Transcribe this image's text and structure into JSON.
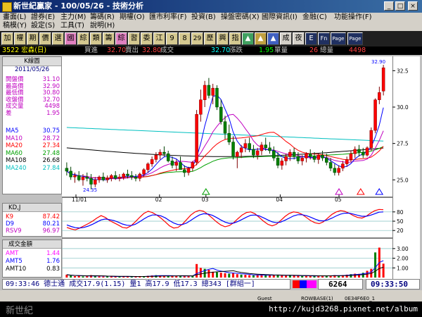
{
  "window": {
    "title": "新世紀贏家 - 100/05/26 - 技術分析"
  },
  "menu": {
    "row1": [
      "畫面(L)",
      "證券(E)",
      "主力(M)",
      "籌碼(R)",
      "期權(O)",
      "匯市利率(F)",
      "投資(B)",
      "操盤密碼(X)",
      "國際資訊(I)",
      "金融(C)",
      "功能操作(F)"
    ],
    "row2": [
      "稿模(Y)",
      "設定(S)",
      "工具(T)",
      "說明(H)"
    ]
  },
  "toolbar": {
    "buttons": [
      "加",
      "權",
      "期",
      "價",
      "選",
      "國",
      "綜",
      "類",
      "籌",
      "綜",
      "習",
      "委",
      "江",
      "9",
      "8",
      "29",
      "歷",
      "興",
      "指",
      "▲",
      "▲",
      "▲",
      "成",
      "夜",
      "E",
      "Fn",
      "Page",
      "Page"
    ]
  },
  "quote": {
    "name": "3522 宏森(日)",
    "buy_label": "買進",
    "buy": "32.70",
    "sell_label": "賣出",
    "sell": "32.80",
    "deal_label": "成交",
    "deal": "32.70",
    "change_label": "漲跌",
    "change": "1.95",
    "vol_label": "單量",
    "vol": "26",
    "total_label": "總量",
    "total": "4498"
  },
  "kpanel": {
    "title": "K線圖",
    "date": "2011/05/26",
    "rows": [
      {
        "label": "開盤價",
        "value": "31.10",
        "color": "#c000c0"
      },
      {
        "label": "最高價",
        "value": "32.90",
        "color": "#c000c0"
      },
      {
        "label": "最低價",
        "value": "30.80",
        "color": "#c000c0"
      },
      {
        "label": "收盤價",
        "value": "32.70",
        "color": "#c000c0"
      },
      {
        "label": "成交量",
        "value": "4498",
        "color": "#c000c0"
      },
      {
        "label": "差",
        "value": "1.95",
        "color": "#c000c0"
      },
      {
        "label": "MA5",
        "value": "30.75",
        "color": "#0000ff"
      },
      {
        "label": "MA10",
        "value": "28.72",
        "color": "#c000c0"
      },
      {
        "label": "MA20",
        "value": "27.34",
        "color": "#ff0000"
      },
      {
        "label": "MA60",
        "value": "27.48",
        "color": "#00a000"
      },
      {
        "label": "MA108",
        "value": "26.68",
        "color": "#000000"
      },
      {
        "label": "MA240",
        "value": "27.84",
        "color": "#00c0c0"
      }
    ]
  },
  "kdpanel": {
    "title": "KD,J",
    "rows": [
      {
        "label": "K9",
        "value": "87.42",
        "color": "#ff0000"
      },
      {
        "label": "D9",
        "value": "80.21",
        "color": "#0000ff"
      },
      {
        "label": "RSV9",
        "value": "96.97",
        "color": "#c000c0"
      }
    ]
  },
  "amtpanel": {
    "title": "成交金額",
    "rows": [
      {
        "label": "AMT",
        "value": "1.44",
        "color": "#ff00ff"
      },
      {
        "label": "AMT5",
        "value": "1.76",
        "color": "#0000ff"
      },
      {
        "label": "AMT10",
        "value": "0.83",
        "color": "#000000"
      }
    ]
  },
  "chart_data": [
    {
      "type": "candlestick",
      "title": "K線圖",
      "x_labels": [
        "11/01",
        "02",
        "03",
        "04",
        "05"
      ],
      "y_ticks": [
        "32.5",
        "30.0",
        "27.5",
        "25.0"
      ],
      "ylim": [
        24,
        33
      ],
      "high_label": "32.90",
      "low_label": "24.35",
      "candles": [
        [
          25.8,
          26.2,
          25.3,
          25.6
        ],
        [
          25.6,
          25.9,
          25.0,
          25.2
        ],
        [
          25.2,
          25.5,
          24.8,
          25.3
        ],
        [
          25.3,
          25.6,
          24.9,
          25.0
        ],
        [
          25.0,
          25.4,
          24.6,
          25.2
        ],
        [
          25.2,
          25.5,
          24.9,
          25.1
        ],
        [
          25.1,
          25.4,
          24.35,
          24.7
        ],
        [
          24.7,
          25.2,
          24.5,
          25.0
        ],
        [
          25.0,
          25.3,
          24.8,
          25.2
        ],
        [
          25.2,
          25.5,
          24.9,
          25.0
        ],
        [
          25.0,
          25.3,
          24.8,
          25.1
        ],
        [
          25.1,
          25.4,
          24.9,
          25.3
        ],
        [
          25.3,
          25.6,
          25.0,
          25.1
        ],
        [
          25.1,
          25.4,
          24.9,
          25.2
        ],
        [
          25.2,
          25.5,
          25.0,
          25.4
        ],
        [
          25.4,
          25.7,
          25.1,
          25.3
        ],
        [
          25.3,
          25.6,
          25.0,
          25.2
        ],
        [
          25.2,
          25.4,
          24.9,
          25.1
        ],
        [
          25.1,
          25.5,
          24.9,
          25.4
        ],
        [
          25.4,
          25.8,
          25.2,
          25.7
        ],
        [
          25.7,
          26.2,
          25.5,
          26.1
        ],
        [
          26.1,
          26.6,
          25.9,
          26.4
        ],
        [
          26.4,
          26.9,
          26.2,
          26.7
        ],
        [
          26.7,
          27.1,
          26.4,
          26.9
        ],
        [
          26.9,
          27.3,
          26.6,
          26.8
        ],
        [
          26.8,
          27.0,
          26.2,
          26.3
        ],
        [
          26.3,
          26.6,
          25.8,
          26.0
        ],
        [
          26.0,
          26.4,
          25.6,
          26.2
        ],
        [
          26.2,
          26.6,
          25.9,
          25.7
        ],
        [
          25.7,
          26.0,
          25.2,
          25.5
        ],
        [
          25.5,
          25.9,
          25.3,
          25.8
        ],
        [
          25.8,
          26.3,
          25.6,
          26.2
        ],
        [
          26.2,
          29.8,
          26.0,
          29.5
        ],
        [
          29.5,
          31.2,
          29.0,
          30.5
        ],
        [
          30.5,
          31.8,
          30.0,
          31.5
        ],
        [
          31.5,
          32.0,
          30.6,
          30.8
        ],
        [
          30.8,
          31.6,
          30.2,
          31.3
        ],
        [
          31.3,
          31.5,
          29.8,
          30.0
        ],
        [
          30.0,
          30.5,
          28.8,
          29.0
        ],
        [
          29.0,
          29.4,
          27.8,
          28.2
        ],
        [
          28.2,
          28.8,
          27.4,
          27.6
        ],
        [
          27.6,
          28.0,
          26.4,
          26.6
        ],
        [
          26.6,
          27.0,
          25.8,
          26.9
        ],
        [
          26.9,
          27.4,
          26.5,
          27.2
        ],
        [
          27.2,
          27.8,
          26.9,
          27.5
        ],
        [
          27.5,
          27.9,
          26.9,
          27.1
        ],
        [
          27.1,
          27.4,
          26.5,
          26.7
        ],
        [
          26.7,
          27.2,
          26.4,
          27.0
        ],
        [
          27.0,
          27.6,
          26.7,
          27.4
        ],
        [
          27.4,
          27.9,
          27.0,
          27.2
        ],
        [
          27.2,
          27.6,
          26.8,
          27.0
        ],
        [
          27.0,
          27.3,
          26.3,
          26.5
        ],
        [
          26.5,
          26.9,
          25.8,
          26.0
        ],
        [
          26.0,
          26.5,
          25.7,
          26.3
        ],
        [
          26.3,
          26.8,
          26.0,
          26.6
        ],
        [
          26.6,
          27.1,
          26.3,
          26.9
        ],
        [
          26.9,
          27.2,
          26.4,
          26.6
        ],
        [
          26.6,
          26.9,
          26.1,
          26.3
        ],
        [
          26.3,
          26.7,
          26.0,
          26.5
        ],
        [
          26.5,
          26.9,
          26.2,
          26.8
        ],
        [
          26.8,
          27.1,
          26.4,
          26.6
        ],
        [
          26.6,
          26.9,
          26.2,
          26.4
        ],
        [
          26.4,
          26.8,
          26.1,
          26.7
        ],
        [
          26.7,
          27.0,
          26.3,
          26.5
        ],
        [
          26.5,
          26.8,
          26.0,
          26.2
        ],
        [
          26.2,
          26.5,
          25.6,
          25.8
        ],
        [
          25.8,
          26.1,
          25.3,
          25.5
        ],
        [
          25.5,
          26.0,
          25.3,
          25.8
        ],
        [
          25.8,
          26.3,
          25.6,
          26.1
        ],
        [
          26.1,
          26.6,
          25.9,
          26.4
        ],
        [
          26.4,
          27.0,
          26.2,
          26.8
        ],
        [
          26.8,
          27.3,
          26.5,
          27.1
        ],
        [
          27.1,
          27.4,
          26.6,
          26.9
        ],
        [
          26.9,
          27.2,
          26.5,
          26.7
        ],
        [
          26.7,
          27.3,
          26.6,
          27.2
        ],
        [
          27.2,
          28.6,
          27.0,
          28.4
        ],
        [
          28.4,
          30.6,
          28.2,
          30.5
        ],
        [
          30.5,
          31.4,
          30.2,
          31.0
        ],
        [
          31.1,
          32.9,
          30.8,
          32.7
        ]
      ]
    },
    {
      "type": "line",
      "title": "KD,J",
      "y_ticks": [
        "80",
        "50",
        "20"
      ],
      "ylim": [
        0,
        100
      ],
      "series": [
        {
          "name": "K9",
          "color": "#ff0000",
          "values": [
            30,
            25,
            22,
            28,
            35,
            42,
            50,
            60,
            68,
            62,
            52,
            45,
            38,
            30,
            28,
            35,
            48,
            62,
            75,
            82,
            78,
            70,
            60,
            48,
            35,
            28,
            30,
            40,
            55,
            70,
            80,
            85,
            82,
            72,
            60,
            48,
            38,
            32,
            36,
            45,
            58,
            70,
            78,
            80,
            74,
            62,
            50,
            40,
            35,
            40,
            52,
            65,
            75,
            80,
            78,
            72,
            62,
            52,
            45,
            42,
            48,
            60,
            72,
            80,
            84,
            82,
            76,
            68,
            62,
            60,
            66,
            76,
            84,
            88,
            87
          ]
        },
        {
          "name": "D9",
          "color": "#0000ff",
          "values": [
            38,
            33,
            29,
            28,
            30,
            34,
            40,
            47,
            54,
            57,
            55,
            52,
            47,
            41,
            37,
            36,
            40,
            48,
            57,
            65,
            70,
            70,
            67,
            61,
            52,
            44,
            39,
            39,
            44,
            53,
            62,
            70,
            74,
            73,
            69,
            62,
            54,
            47,
            43,
            44,
            49,
            56,
            63,
            69,
            70,
            67,
            61,
            54,
            48,
            45,
            47,
            53,
            60,
            67,
            71,
            71,
            68,
            63,
            57,
            52,
            51,
            54,
            60,
            67,
            73,
            76,
            76,
            73,
            69,
            66,
            66,
            69,
            74,
            79,
            80
          ]
        }
      ]
    },
    {
      "type": "bar",
      "title": "成交金額",
      "y_ticks": [
        "3.00",
        "2.00",
        "1.00"
      ],
      "ylim": [
        0,
        3.5
      ],
      "values": [
        0.3,
        0.2,
        0.15,
        0.18,
        0.12,
        0.14,
        0.25,
        0.16,
        0.12,
        0.1,
        0.11,
        0.13,
        0.1,
        0.09,
        0.12,
        0.11,
        0.1,
        0.09,
        0.12,
        0.14,
        0.18,
        0.22,
        0.25,
        0.2,
        0.18,
        0.15,
        0.16,
        0.18,
        0.2,
        0.15,
        0.14,
        0.16,
        1.4,
        1.0,
        0.9,
        0.8,
        0.6,
        0.55,
        0.5,
        0.45,
        0.4,
        0.48,
        0.35,
        0.3,
        0.28,
        0.25,
        0.22,
        0.3,
        0.26,
        0.24,
        0.22,
        0.25,
        0.3,
        0.2,
        0.18,
        0.22,
        0.2,
        0.18,
        0.16,
        0.19,
        0.17,
        0.15,
        0.2,
        0.18,
        0.16,
        0.22,
        0.25,
        0.2,
        0.24,
        0.3,
        0.35,
        0.4,
        0.38,
        0.5,
        0.7,
        0.9,
        2.6,
        3.1,
        1.44
      ],
      "series_lines": [
        {
          "name": "AMT5",
          "color": "#0000ff"
        },
        {
          "name": "AMT10",
          "color": "#000000"
        }
      ]
    }
  ],
  "ticker": {
    "text": "09:33:46 德士通 成交17.9(1.15) 量1 高17.9 低17.3 總343 [群組一]",
    "code": "6264",
    "time": "09:33:50"
  },
  "statusbar": {
    "guest": "Guest",
    "row": "ROWBASE(1)",
    "code": "0E34F6E0_1"
  },
  "watermark": "http://kujd3268.pixnet.net/album",
  "watermark2": "新世紀"
}
